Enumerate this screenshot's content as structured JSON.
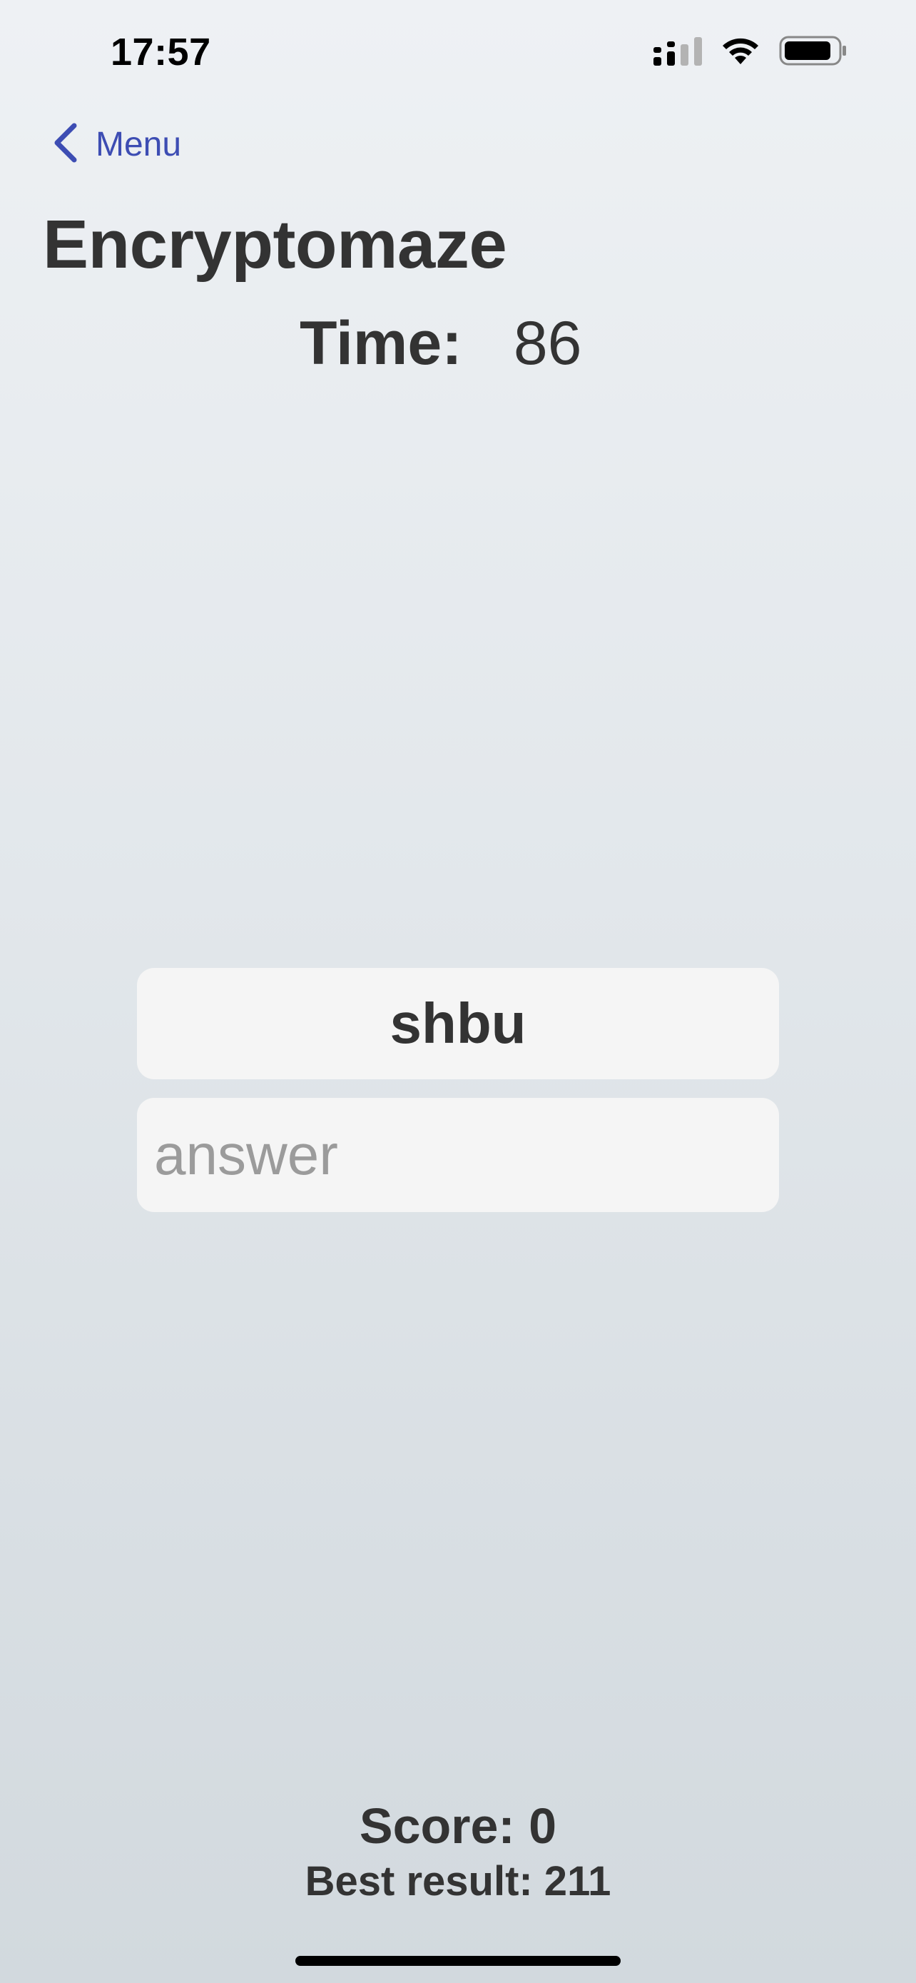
{
  "status_bar": {
    "time": "17:57",
    "icons": [
      "cellular-signal-icon",
      "wifi-icon",
      "battery-icon"
    ]
  },
  "nav": {
    "back_label": "Menu",
    "back_icon": "chevron-left-icon"
  },
  "page": {
    "title": "Encryptomaze"
  },
  "timer": {
    "label": "Time:",
    "value": "86"
  },
  "puzzle": {
    "encrypted_word": "shbu"
  },
  "answer_input": {
    "value": "",
    "placeholder": "answer"
  },
  "stats": {
    "score_text": "Score: 0",
    "best_result_text": "Best result: 211"
  },
  "colors": {
    "accent": "#3d4db3",
    "text": "#333333",
    "card_background": "#f5f5f5",
    "placeholder": "#9b9b9b"
  }
}
